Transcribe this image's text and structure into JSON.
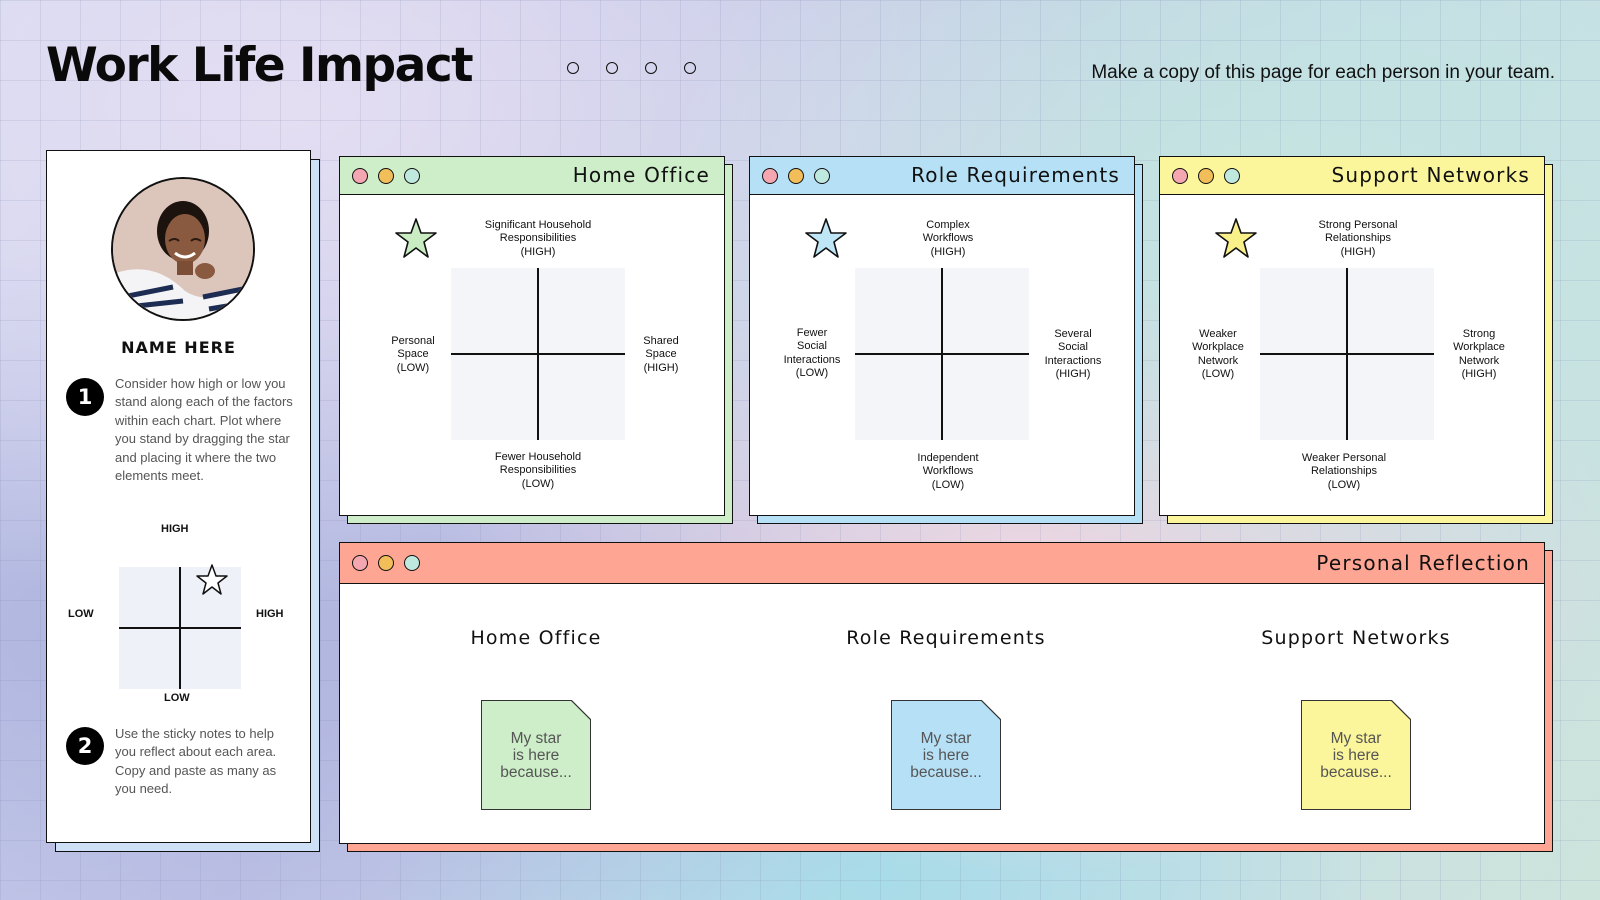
{
  "header": {
    "title": "Work Life Impact",
    "subtitle": "Make a copy of this page for each person in your team."
  },
  "sidebar": {
    "name": "NAME HERE",
    "step1": {
      "number": "1",
      "text": "Consider how high or low you stand along each of the factors within each chart. Plot where you stand by dragging the star and placing it where the two elements meet."
    },
    "step2": {
      "number": "2",
      "text": "Use the sticky notes to help you reflect about each area. Copy and paste as many as you need."
    },
    "example": {
      "top": "HIGH",
      "bottom": "LOW",
      "left": "LOW",
      "right": "HIGH"
    }
  },
  "panels": [
    {
      "title": "Home Office",
      "color": "#cdeec8",
      "star_color": "#c9ecc2",
      "top": "Significant Household\nResponsibilities\n(HIGH)",
      "bottom": "Fewer Household\nResponsibilities\n(LOW)",
      "left": "Personal\nSpace\n(LOW)",
      "right": "Shared\nSpace\n(HIGH)"
    },
    {
      "title": "Role Requirements",
      "color": "#b6e0f6",
      "star_color": "#bfe6f6",
      "top": "Complex\nWorkflows\n(HIGH)",
      "bottom": "Independent\nWorkflows\n(LOW)",
      "left": "Fewer\nSocial\nInteractions\n(LOW)",
      "right": "Several\nSocial\nInteractions\n(HIGH)"
    },
    {
      "title": "Support Networks",
      "color": "#fbf59c",
      "star_color": "#faf08a",
      "top": "Strong Personal\nRelationships\n(HIGH)",
      "bottom": "Weaker Personal\nRelationships\n(LOW)",
      "left": "Weaker\nWorkplace\nNetwork\n(LOW)",
      "right": "Strong\nWorkplace\nNetwork\n(HIGH)"
    }
  ],
  "reflection": {
    "title": "Personal Reflection",
    "color": "#ffa594",
    "columns": [
      {
        "title": "Home Office",
        "note": "My star\nis here\nbecause...",
        "note_color": "#cdeec8"
      },
      {
        "title": "Role Requirements",
        "note": "My star\nis here\nbecause...",
        "note_color": "#b6e0f6"
      },
      {
        "title": "Support Networks",
        "note": "My star\nis here\nbecause...",
        "note_color": "#fbf59c"
      }
    ]
  }
}
